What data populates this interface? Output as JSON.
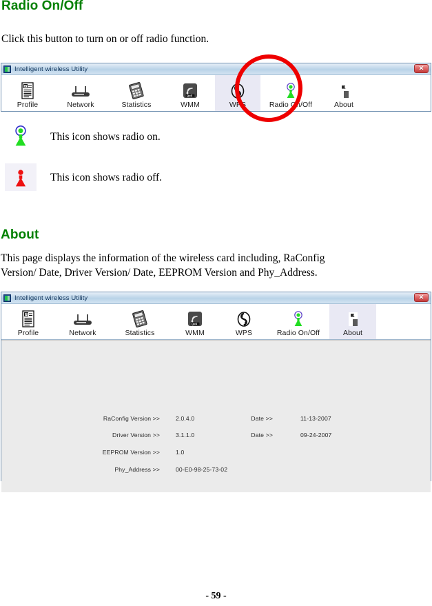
{
  "document": {
    "section_radio": {
      "heading": "Radio On/Off",
      "intro": "Click this button to turn on or off radio function.",
      "legend": [
        {
          "icon": "radio-on-icon",
          "text": "This icon shows radio on."
        },
        {
          "icon": "radio-off-icon",
          "text": "This icon shows radio off."
        }
      ]
    },
    "section_about": {
      "heading": "About",
      "intro_line1": "This page displays the information of the wireless card including, RaConfig",
      "intro_line2": "Version/ Date, Driver Version/ Date, EEPROM Version and Phy_Address."
    },
    "page_number": "- 59 -"
  },
  "window_radio": {
    "title": "Intelligent wireless Utility",
    "title_icon": "app-icon",
    "close_label": "✕",
    "tabs": [
      {
        "label": "Profile",
        "icon": "profile-icon",
        "selected": false
      },
      {
        "label": "Network",
        "icon": "network-icon",
        "selected": false
      },
      {
        "label": "Statistics",
        "icon": "statistics-icon",
        "selected": false
      },
      {
        "label": "WMM",
        "icon": "wmm-icon",
        "selected": false
      },
      {
        "label": "WPS",
        "icon": "wps-icon",
        "selected": true
      },
      {
        "label": "Radio On/Off",
        "icon": "radio-on-icon",
        "selected": false
      },
      {
        "label": "About",
        "icon": "about-icon",
        "selected": false
      }
    ],
    "annotation": {
      "shape": "circle",
      "color": "#ee0000",
      "targets": "Radio On/Off"
    }
  },
  "window_about": {
    "title": "Intelligent wireless Utility",
    "title_icon": "app-icon",
    "close_label": "✕",
    "tabs": [
      {
        "label": "Profile",
        "icon": "profile-icon",
        "selected": false
      },
      {
        "label": "Network",
        "icon": "network-icon",
        "selected": false
      },
      {
        "label": "Statistics",
        "icon": "statistics-icon",
        "selected": false
      },
      {
        "label": "WMM",
        "icon": "wmm-icon",
        "selected": false
      },
      {
        "label": "WPS",
        "icon": "wps-icon",
        "selected": false
      },
      {
        "label": "Radio On/Off",
        "icon": "radio-on-icon",
        "selected": false
      },
      {
        "label": "About",
        "icon": "about-icon",
        "selected": true
      }
    ],
    "info": {
      "raconfig_version_label": "RaConfig Version >>",
      "raconfig_version_value": "2.0.4.0",
      "raconfig_date_label": "Date >>",
      "raconfig_date_value": "11-13-2007",
      "driver_version_label": "Driver Version >>",
      "driver_version_value": "3.1.1.0",
      "driver_date_label": "Date >>",
      "driver_date_value": "09-24-2007",
      "eeprom_version_label": "EEPROM Version >>",
      "eeprom_version_value": "1.0",
      "phy_address_label": "Phy_Address >>",
      "phy_address_value": "00-E0-98-25-73-02"
    }
  },
  "colors": {
    "heading_green": "#008000",
    "annotation_red": "#ee0000",
    "radio_on_green": "#22dd22",
    "radio_off_red": "#ee1111",
    "tab_selected_bg": "#e9e9f4"
  }
}
